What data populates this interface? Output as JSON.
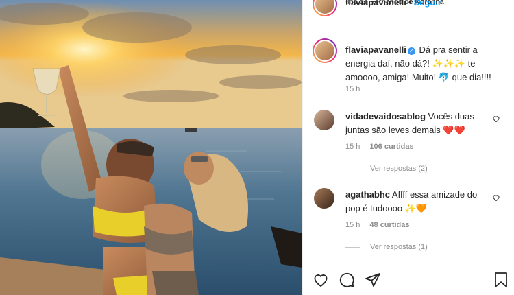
{
  "post": {
    "author": "flaviapavanelli",
    "follow_label": "Seguir",
    "location": "Ilha de Fernando de Noronha",
    "more_label": "···"
  },
  "caption": {
    "username": "flaviapavanelli",
    "verified_glyph": "✓",
    "text": "Dá pra sentir a energia daí, não dá?! ✨✨✨ te amoooo, amiga! Muito! 🐬 que dia!!!!",
    "time": "15 h"
  },
  "comments": [
    {
      "username": "vidadevaidosablog",
      "text": "Vocês duas juntas são leves demais ❤️❤️",
      "time": "15 h",
      "likes": "106 curtidas",
      "replies": "Ver respostas (2)"
    },
    {
      "username": "agathabhc",
      "text": "Affff essa amizade do pop é tudoooo ✨🧡",
      "time": "15 h",
      "likes": "48 curtidas",
      "replies": "Ver respostas (1)"
    }
  ],
  "icons": {
    "like": "heart-outline-icon",
    "comment": "speech-bubble-icon",
    "share": "paper-plane-icon",
    "save": "bookmark-icon",
    "comment_like": "heart-outline-icon"
  },
  "colors": {
    "follow": "#0095f6",
    "meta": "#8e8e8e",
    "verified": "#3897f0"
  }
}
